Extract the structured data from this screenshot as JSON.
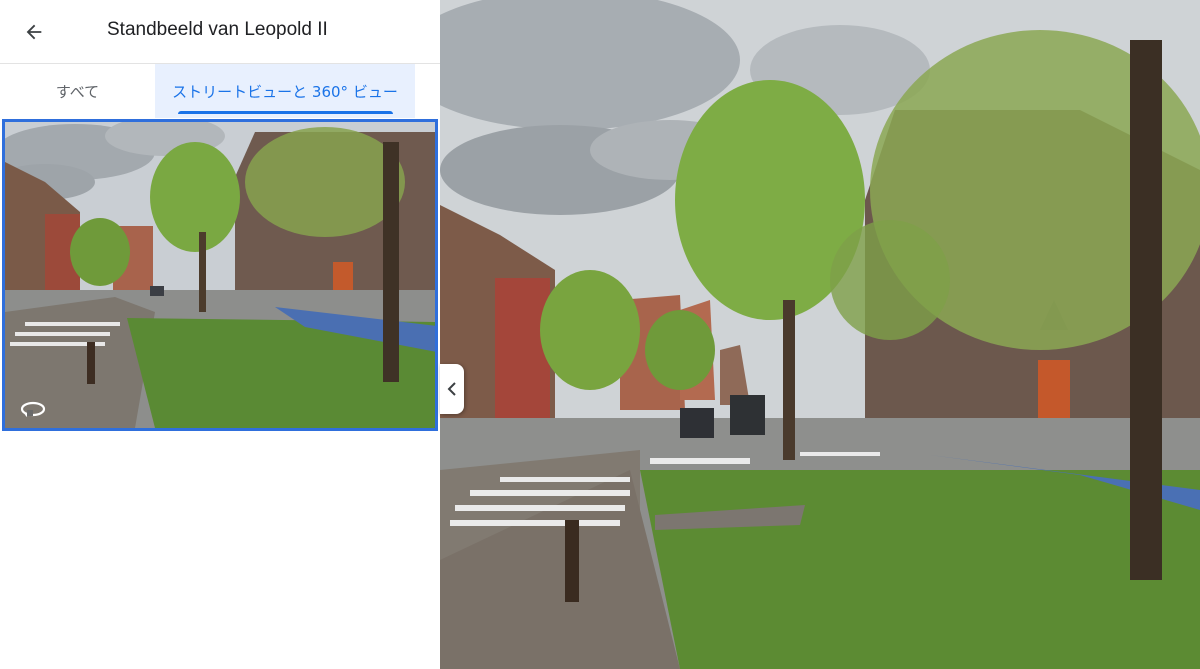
{
  "header": {
    "title": "Standbeeld van Leopold II",
    "back_icon": "arrow-left-icon"
  },
  "tabs": [
    {
      "label": "すべて",
      "selected": false
    },
    {
      "label": "ストリートビューと 360° ビュー",
      "selected": true
    }
  ],
  "thumbnail": {
    "icon": "360-rotate-icon",
    "selected": true
  },
  "panel_toggle": {
    "icon": "chevron-left-icon"
  },
  "colors": {
    "accent": "#1a73e8",
    "selected_tab_bg": "#e8f0fe",
    "thumb_border": "#2f6fdc"
  }
}
